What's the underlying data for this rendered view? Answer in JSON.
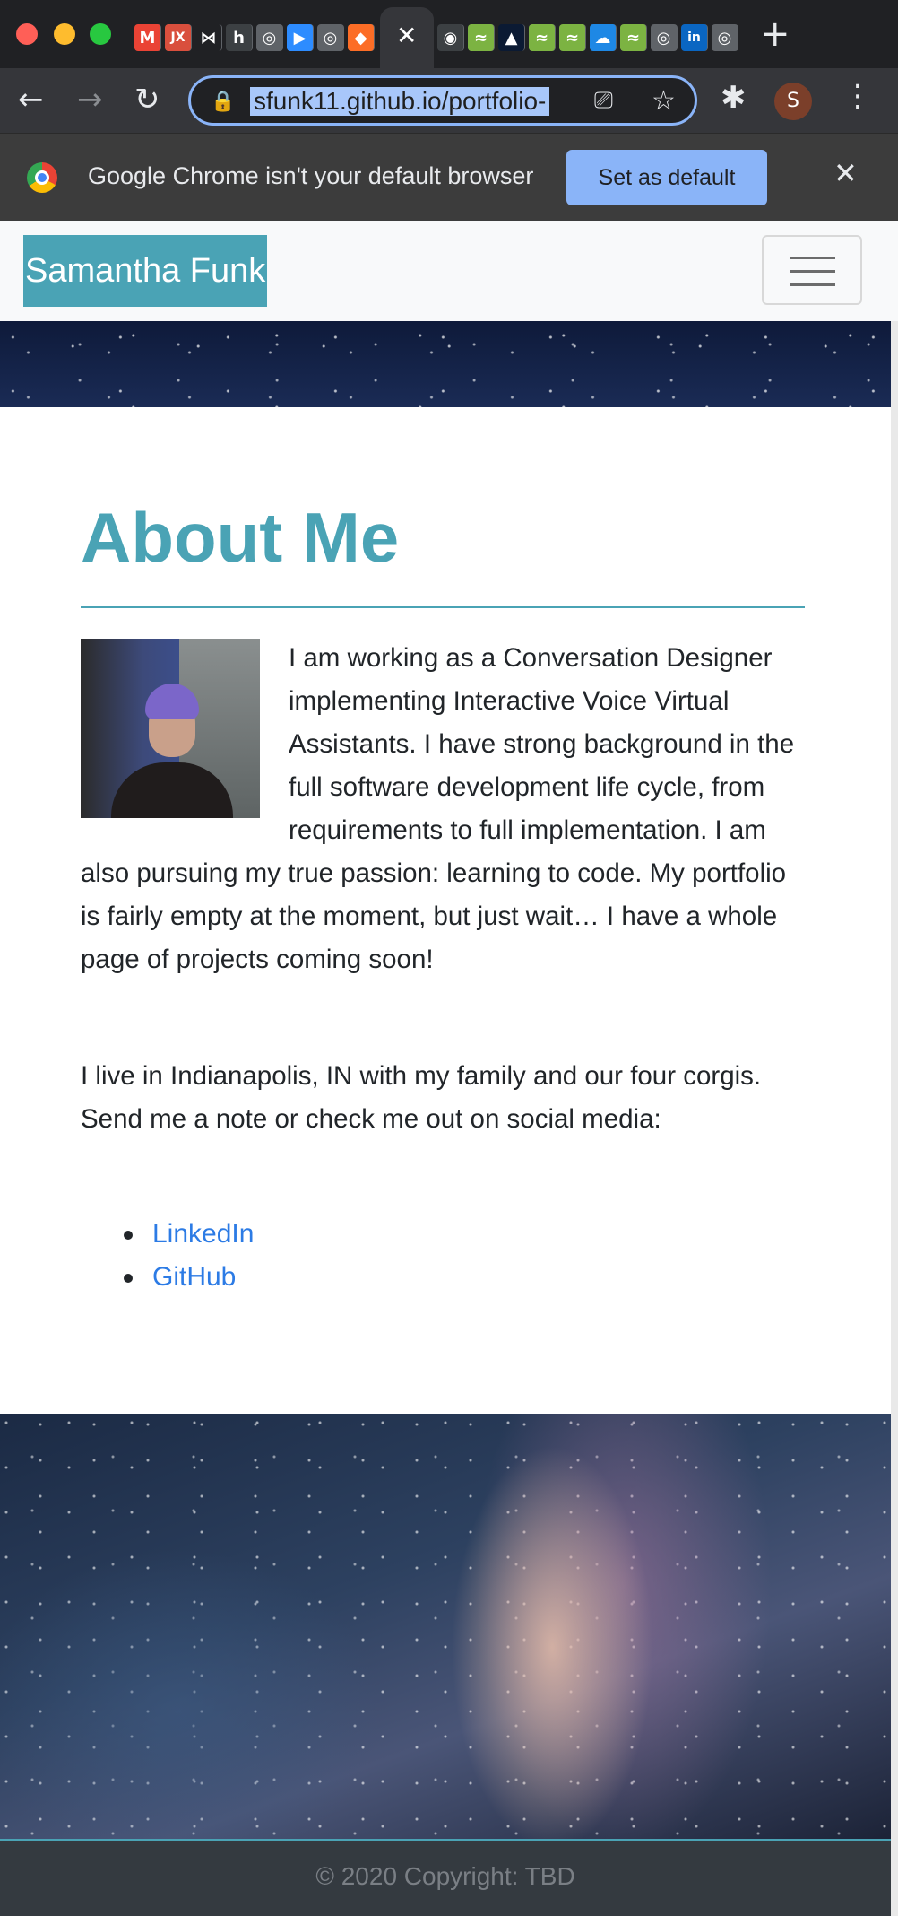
{
  "browser": {
    "tab_close_glyph": "✕",
    "new_tab_glyph": "+",
    "back_glyph": "←",
    "forward_glyph": "→",
    "reload_glyph": "↻",
    "lock_glyph": "🔒",
    "url": "sfunk11.github.io/portfolio-",
    "star_glyph": "☆",
    "cast_glyph": "⎚",
    "extensions_glyph": "✱",
    "profile_initial": "S",
    "menu_glyph": "⋮",
    "tab_favicons": [
      {
        "icon": "gmail-icon",
        "glyph": "M",
        "color": "#ea4335"
      },
      {
        "icon": "jx-icon",
        "glyph": "JX",
        "color": "#d94f3d"
      },
      {
        "icon": "bow-icon",
        "glyph": "⋈",
        "color": "#202124"
      },
      {
        "icon": "h-icon",
        "glyph": "h",
        "color": "#3c4043"
      },
      {
        "icon": "globe-icon",
        "glyph": "◎",
        "color": "#5f6368"
      },
      {
        "icon": "zoom-icon",
        "glyph": "▶",
        "color": "#2d8cff"
      },
      {
        "icon": "globe-icon-2",
        "glyph": "◎",
        "color": "#5f6368"
      },
      {
        "icon": "gitlab-icon",
        "glyph": "◆",
        "color": "#fc6d26"
      }
    ],
    "tab_favicons_right": [
      {
        "icon": "github-icon",
        "glyph": "◉",
        "color": "#3c4043"
      },
      {
        "icon": "chart-icon",
        "glyph": "≈",
        "color": "#7cb342"
      },
      {
        "icon": "atlassian-icon",
        "glyph": "▲",
        "color": "#0b1a33"
      },
      {
        "icon": "chart-icon-2",
        "glyph": "≈",
        "color": "#7cb342"
      },
      {
        "icon": "chart-icon-3",
        "glyph": "≈",
        "color": "#7cb342"
      },
      {
        "icon": "cloud-icon",
        "glyph": "☁",
        "color": "#1e88e5"
      },
      {
        "icon": "chart-icon-4",
        "glyph": "≈",
        "color": "#7cb342"
      },
      {
        "icon": "globe-icon-3",
        "glyph": "◎",
        "color": "#5f6368"
      },
      {
        "icon": "linkedin-icon",
        "glyph": "in",
        "color": "#0a66c2"
      },
      {
        "icon": "globe-icon-4",
        "glyph": "◎",
        "color": "#5f6368"
      }
    ]
  },
  "infobar": {
    "message": "Google Chrome isn't your default browser",
    "button_label": "Set as default",
    "close_glyph": "✕"
  },
  "navbar": {
    "brand": "Samantha Funk",
    "toggler_label": "menu-toggle"
  },
  "about": {
    "heading": "About Me",
    "paragraph1": "I am working as a Conversation Designer implementing Interactive Voice Virtual Assistants. I have strong background in the full software development life cycle, from requirements to full implementation. I am also pursuing my true passion: learning to code. My portfolio is fairly empty at the moment, but just wait… I have a whole page of projects coming soon!",
    "paragraph2": "I live in Indianapolis, IN with my family and our four corgis. Send me a note or check me out on social media:",
    "links": [
      {
        "label": "LinkedIn"
      },
      {
        "label": "GitHub"
      }
    ]
  },
  "footer": {
    "text": "© 2020 Copyright: TBD"
  },
  "colors": {
    "accent": "#4aa3b5",
    "link": "#2c7be5",
    "footer_bg": "#343a40",
    "chrome_dark": "#202124"
  }
}
